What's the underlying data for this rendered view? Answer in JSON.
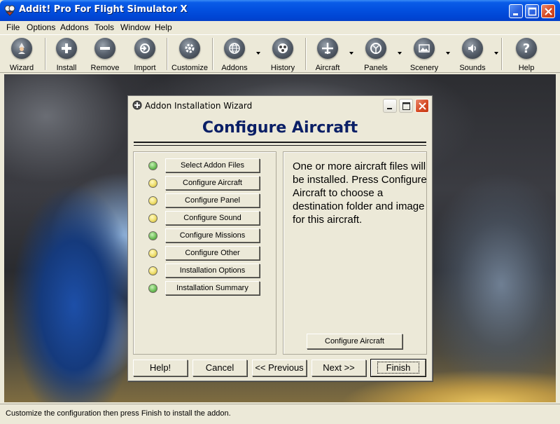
{
  "app": {
    "title": "Addit! Pro For Flight Simulator X"
  },
  "menu": [
    "File",
    "Options",
    "Addons",
    "Tools",
    "Window",
    "Help"
  ],
  "toolbar": [
    {
      "label": "Wizard",
      "icon": "wizard-icon"
    },
    {
      "label": "Install",
      "icon": "plus-icon"
    },
    {
      "label": "Remove",
      "icon": "minus-icon"
    },
    {
      "label": "Import",
      "icon": "import-icon"
    },
    {
      "label": "Customize",
      "icon": "gear-icon"
    },
    {
      "label": "Addons",
      "icon": "globe-icon"
    },
    {
      "label": "History",
      "icon": "film-icon"
    },
    {
      "label": "Aircraft",
      "icon": "airplane-icon"
    },
    {
      "label": "Panels",
      "icon": "gauge-icon"
    },
    {
      "label": "Scenery",
      "icon": "landscape-icon"
    },
    {
      "label": "Sounds",
      "icon": "speaker-icon"
    },
    {
      "label": "Help",
      "icon": "question-icon"
    }
  ],
  "dialog": {
    "title": "Addon Installation Wizard",
    "heading": "Configure Aircraft",
    "steps": [
      {
        "label": "Select Addon Files",
        "status": "green"
      },
      {
        "label": "Configure Aircraft",
        "status": "yellow"
      },
      {
        "label": "Configure Panel",
        "status": "yellow"
      },
      {
        "label": "Configure Sound",
        "status": "yellow"
      },
      {
        "label": "Configure Missions",
        "status": "green"
      },
      {
        "label": "Configure Other",
        "status": "yellow"
      },
      {
        "label": "Installation Options",
        "status": "yellow"
      },
      {
        "label": "Installation Summary",
        "status": "green"
      }
    ],
    "description": "One or more aircraft files will be installed. Press Configure Aircraft to choose a destination folder and image for this aircraft.",
    "configure_button": "Configure Aircraft",
    "buttons": {
      "help": "Help!",
      "cancel": "Cancel",
      "previous": "<< Previous",
      "next": "Next >>",
      "finish": "Finish"
    }
  },
  "status": "Customize the configuration then press Finish to install the addon."
}
